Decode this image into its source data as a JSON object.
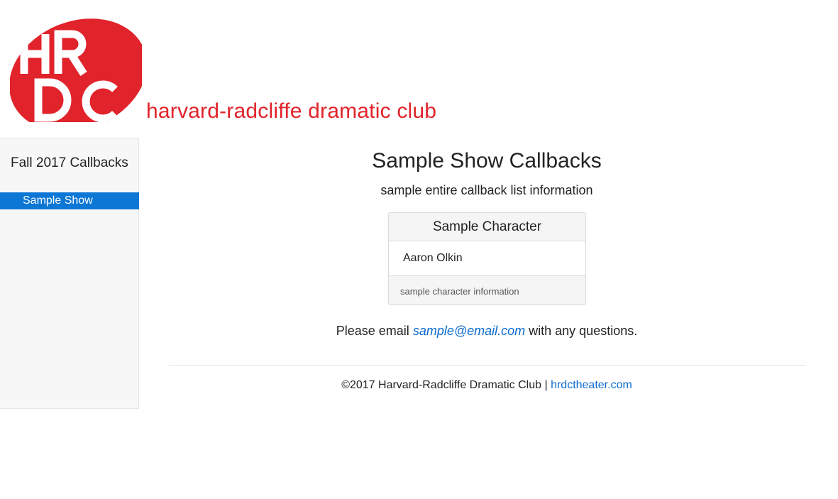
{
  "header": {
    "logo_text": "HRDC",
    "club_name": "harvard-radcliffe dramatic club",
    "brand_color": "#e1232b"
  },
  "sidebar": {
    "title": "Fall 2017 Callbacks",
    "items": [
      {
        "label": "Sample Show",
        "active": true
      }
    ],
    "active_color": "#0d77d5"
  },
  "main": {
    "title": "Sample Show Callbacks",
    "subtitle": "sample entire callback list information",
    "card": {
      "character": "Sample Character",
      "actor": "Aaron Olkin",
      "info": "sample character information"
    },
    "contact": {
      "prefix": "Please email ",
      "email": "sample@email.com",
      "suffix": " with any questions."
    }
  },
  "footer": {
    "copyright": "©2017 Harvard-Radcliffe Dramatic Club | ",
    "link_text": "hrdctheater.com",
    "link_color": "#0d6bd0"
  }
}
